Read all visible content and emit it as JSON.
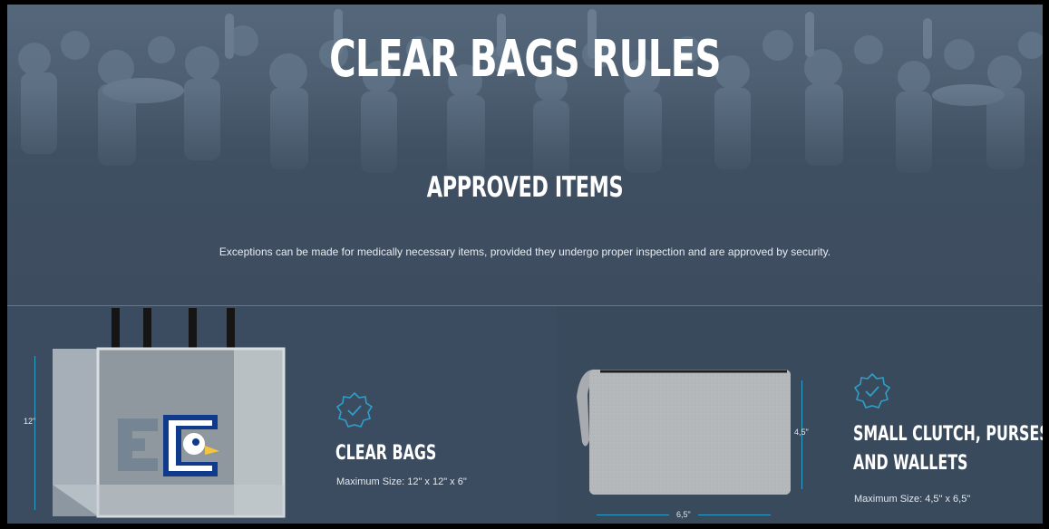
{
  "header": {
    "title": "CLEAR BAGS RULES"
  },
  "approved": {
    "title": "APPROVED ITEMS",
    "note": "Exceptions can be made for medically necessary items, provided they undergo proper inspection and are approved by security."
  },
  "items": [
    {
      "title": "CLEAR BAGS",
      "size": "Maximum Size: 12\" x 12\" x  6\"",
      "dimension_height": "12\"",
      "icon": "check-badge-icon"
    },
    {
      "title_line1": "SMALL CLUTCH, PURSES",
      "title_line2": "AND WALLETS",
      "size": "Maximum Size: 4,5\" x  6,5\"",
      "dimension_height": "4,5\"",
      "dimension_width": "6,5\"",
      "icon": "check-badge-icon"
    }
  ],
  "colors": {
    "background": "#3b4a5c",
    "accent": "#2e9fc8",
    "text": "#ffffff"
  }
}
